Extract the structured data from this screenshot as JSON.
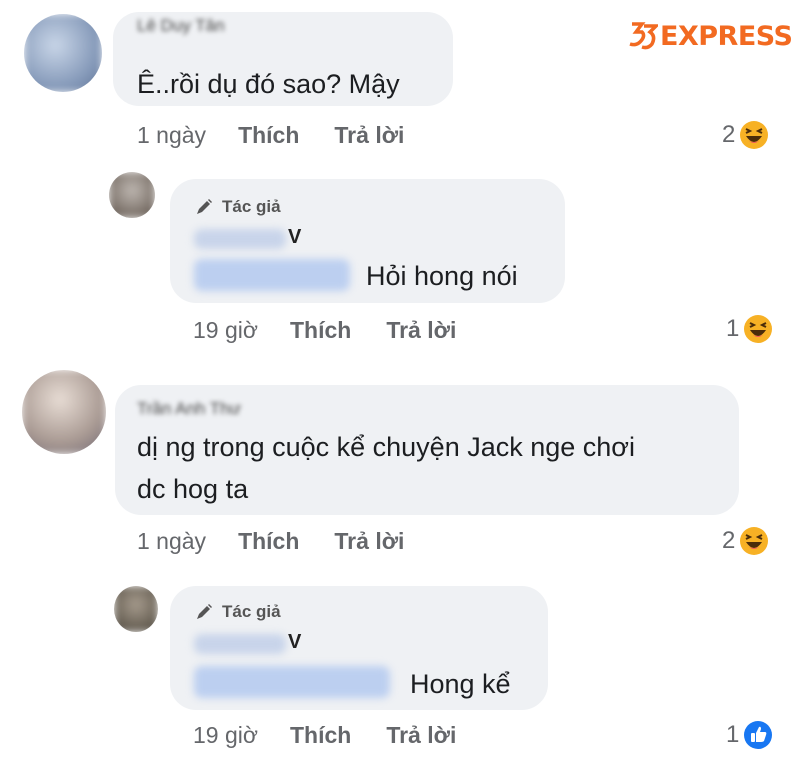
{
  "watermark": {
    "text": "EXPRESS",
    "color": "#f26a21",
    "logo_icon": "35-logo-icon"
  },
  "author_badge_label": "Tác giả",
  "comments": [
    {
      "name_blurred": "Lê Duy Tân",
      "text": "Ê..rồi dụ đó sao? Mậy",
      "time": "1 ngày",
      "like_label": "Thích",
      "reply_label": "Trả lời",
      "reaction_count": "2",
      "reaction_icon": "haha-icon",
      "reply": {
        "name_initial": "V",
        "text": "Hỏi hong nói",
        "time": "19 giờ",
        "like_label": "Thích",
        "reply_label": "Trả lời",
        "reaction_count": "1",
        "reaction_icon": "haha-icon"
      }
    },
    {
      "name_blurred": "Trần Anh Thư",
      "text_line1": "dị ng trong cuộc kể chuyện Jack nge chơi",
      "text_line2": "dc hog ta",
      "time": "1 ngày",
      "like_label": "Thích",
      "reply_label": "Trả lời",
      "reaction_count": "2",
      "reaction_icon": "haha-icon",
      "reply": {
        "name_initial": "V",
        "text": "Hong kể",
        "time": "19 giờ",
        "like_label": "Thích",
        "reply_label": "Trả lời",
        "reaction_count": "1",
        "reaction_icon": "like-icon"
      }
    }
  ]
}
